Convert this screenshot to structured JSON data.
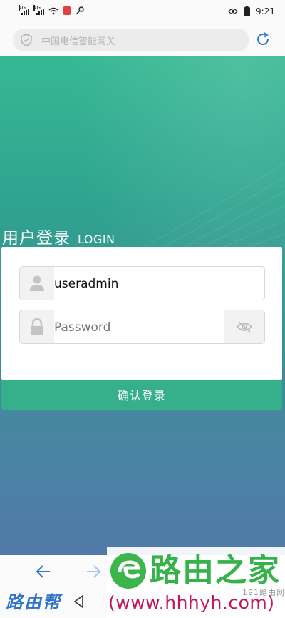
{
  "status_bar": {
    "sim1": "4G",
    "sim2": "4G",
    "time": "9:21"
  },
  "address_bar": {
    "url_text": "中国电信智能网关"
  },
  "login": {
    "title_cn": "用户登录",
    "title_en": "LOGIN",
    "username_value": "useradmin",
    "password_placeholder": "Password",
    "submit_label": "确认登录"
  },
  "watermark": {
    "left_text": "路由帮",
    "brand_cn": "路由之家",
    "url": "(www.hhhyh.com)",
    "sub": "191路由网"
  },
  "colors": {
    "accent": "#35b08a",
    "hero_top": "#37b894",
    "hero_bottom": "#5079a8"
  }
}
